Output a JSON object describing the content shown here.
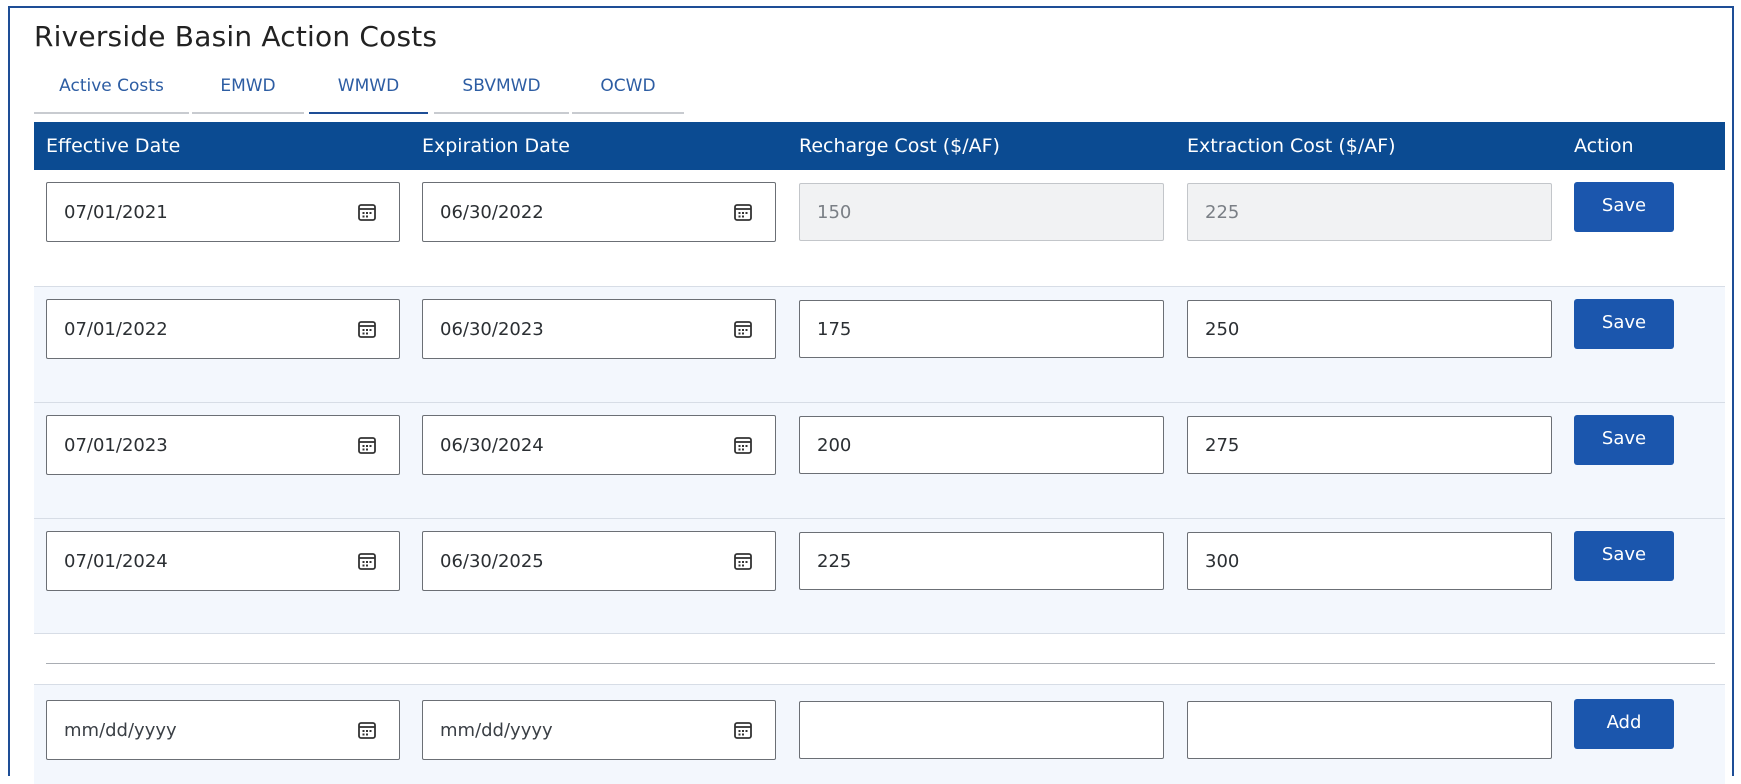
{
  "page": {
    "title": "Riverside Basin Action Costs"
  },
  "tabs": [
    {
      "label": "Active Costs",
      "active": false
    },
    {
      "label": "EMWD",
      "active": false
    },
    {
      "label": "WMWD",
      "active": true
    },
    {
      "label": "SBVMWD",
      "active": false
    },
    {
      "label": "OCWD",
      "active": false
    }
  ],
  "table": {
    "headers": [
      "Effective Date",
      "Expiration Date",
      "Recharge Cost ($/AF)",
      "Extraction Cost ($/AF)",
      "Action"
    ],
    "rows": [
      {
        "effective": "07/01/2021",
        "expiration": "06/30/2022",
        "recharge": "150",
        "extraction": "225",
        "action": "Save",
        "readonly": true
      },
      {
        "effective": "07/01/2022",
        "expiration": "06/30/2023",
        "recharge": "175",
        "extraction": "250",
        "action": "Save",
        "readonly": false
      },
      {
        "effective": "07/01/2023",
        "expiration": "06/30/2024",
        "recharge": "200",
        "extraction": "275",
        "action": "Save",
        "readonly": false
      },
      {
        "effective": "07/01/2024",
        "expiration": "06/30/2025",
        "recharge": "225",
        "extraction": "300",
        "action": "Save",
        "readonly": false
      }
    ],
    "new_row": {
      "effective_placeholder": "mm/dd/yyyy",
      "expiration_placeholder": "mm/dd/yyyy",
      "recharge": "",
      "extraction": "",
      "action": "Add"
    }
  },
  "icons": {
    "date_picker": "calendar-icon"
  },
  "colors": {
    "header_bg": "#0b4b92",
    "button_bg": "#1b56ad",
    "frame": "#1e4e96",
    "tab_text": "#2d5da3"
  }
}
